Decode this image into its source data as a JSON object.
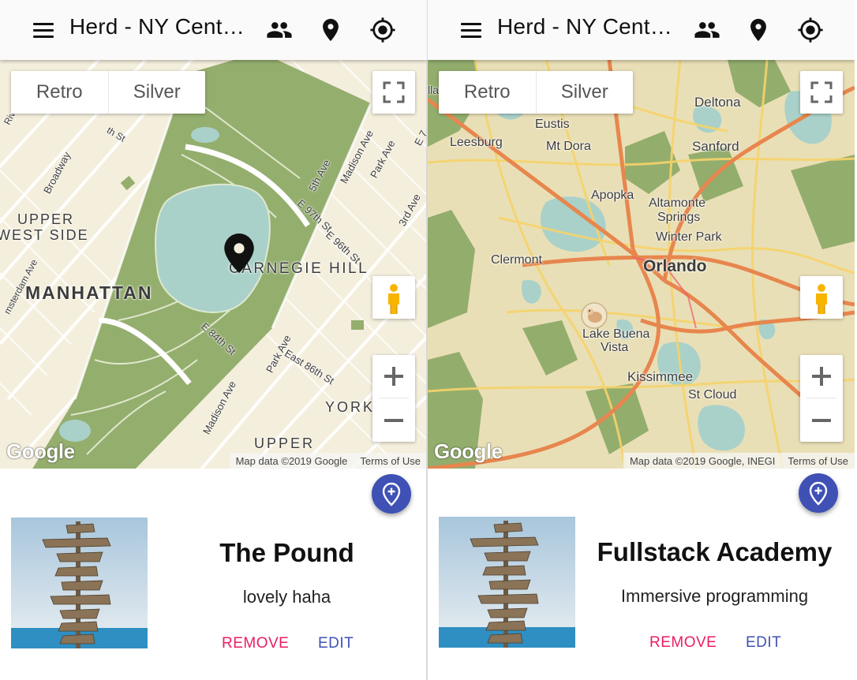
{
  "screens": [
    {
      "app_title": "Herd - NY Central",
      "map": {
        "style_buttons": [
          "Retro",
          "Silver"
        ],
        "google_logo": "Google",
        "attribution": "Map data ©2019 Google",
        "terms": "Terms of Use",
        "labels": [
          "Riverside",
          "Broadway",
          "UPPER",
          "WEST SIDE",
          "MANHATTAN",
          "CARNEGIE HILL",
          "E 97th St",
          "E 96th St",
          "E 84th St",
          "East 86th St",
          "5th Ave",
          "Madison Ave",
          "Park Ave",
          "3rd Ave",
          "Park Ave",
          "Madison Ave",
          "YORK",
          "UPPER",
          "msterdam Ave",
          "th St",
          "E 7"
        ]
      },
      "place": {
        "name": "The Pound",
        "description": "lovely haha",
        "remove_label": "REMOVE",
        "edit_label": "EDIT"
      }
    },
    {
      "app_title": "Herd - NY Central",
      "map": {
        "style_buttons": [
          "Retro",
          "Silver"
        ],
        "google_logo": "Google",
        "attribution": "Map data ©2019 Google, INEGI",
        "terms": "Terms of Use",
        "labels": [
          "Deltona",
          "Eustis",
          "Leesburg",
          "Mt Dora",
          "Sanford",
          "Apopka",
          "Altamonte",
          "Springs",
          "Winter Park",
          "Clermont",
          "Orlando",
          "Lake Buena",
          "Vista",
          "Kissimmee",
          "St Cloud",
          "lla"
        ]
      },
      "place": {
        "name": "Fullstack Academy",
        "description": "Immersive programming",
        "remove_label": "REMOVE",
        "edit_label": "EDIT"
      }
    }
  ],
  "colors": {
    "accent": "#3f51b5",
    "remove": "#e91e63",
    "map_water": "#a9d1c9",
    "map_park": "#93ad6d",
    "map_land": "#f3ecd8",
    "orlando_land": "#e9dfb6",
    "orlando_highway": "#e7864e"
  },
  "icons": [
    "menu-icon",
    "people-icon",
    "location-pin-icon",
    "my-location-icon",
    "fullscreen-icon",
    "pegman-icon",
    "zoom-in-icon",
    "zoom-out-icon",
    "add-location-icon",
    "map-marker-icon"
  ]
}
